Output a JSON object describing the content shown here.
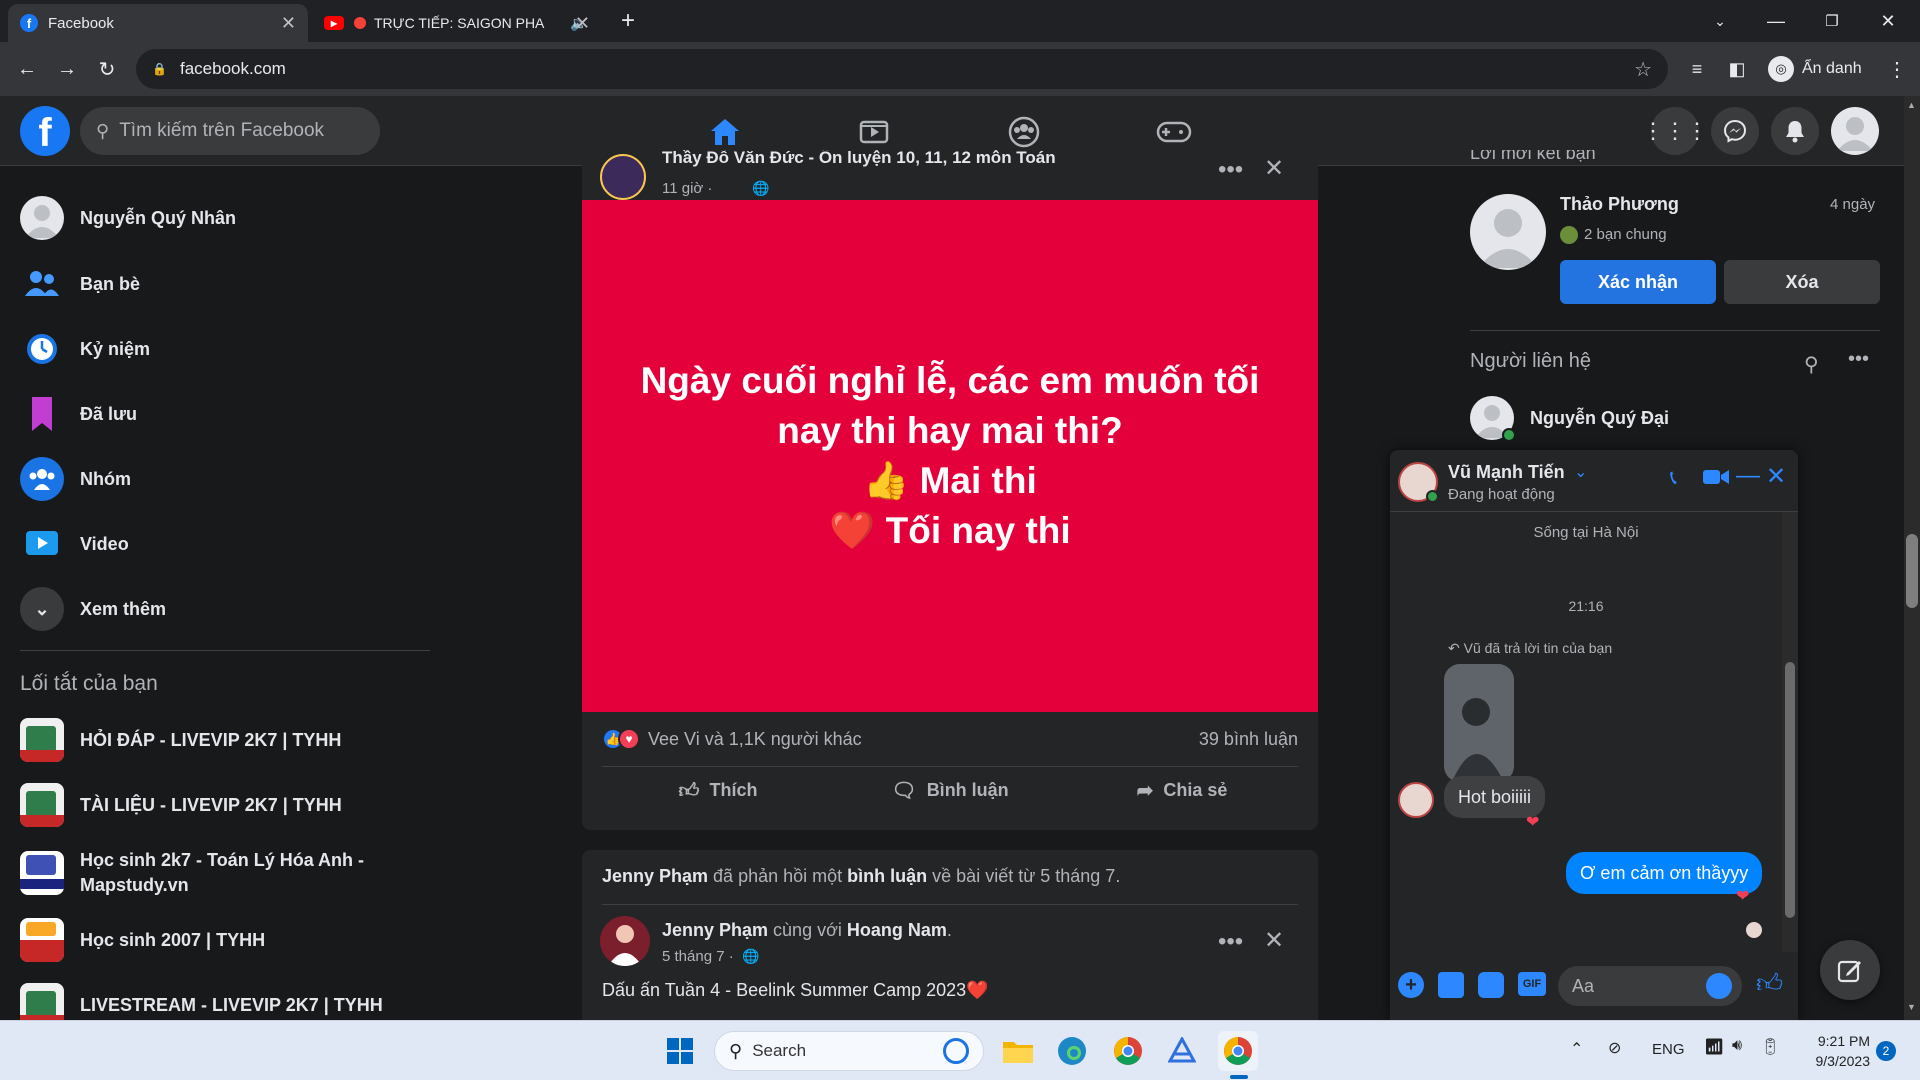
{
  "browser": {
    "tabs": [
      {
        "title": "Facebook",
        "active": true
      },
      {
        "title": "TRỰC TIẾP: SAIGON PHA",
        "active": false
      }
    ],
    "new_tab": "+",
    "url": "facebook.com",
    "profile_label": "Ẩn danh"
  },
  "fb": {
    "search_placeholder": "Tìm kiếm trên Facebook",
    "accent": "#2d88ff"
  },
  "left": {
    "profile_name": "Nguyễn Quý Nhân",
    "items": [
      {
        "label": "Bạn bè",
        "icon": "friends-icon"
      },
      {
        "label": "Kỷ niệm",
        "icon": "memories-icon"
      },
      {
        "label": "Đã lưu",
        "icon": "saved-icon"
      },
      {
        "label": "Nhóm",
        "icon": "groups-icon"
      },
      {
        "label": "Video",
        "icon": "video-icon"
      },
      {
        "label": "Xem thêm",
        "icon": "chevron-down-icon"
      }
    ],
    "shortcuts_title": "Lối tắt của bạn",
    "shortcuts": [
      "HỎI ĐÁP - LIVEVIP 2K7 | TYHH",
      "TÀI LIỆU - LIVEVIP 2K7 | TYHH",
      "Học sinh 2k7 - Toán Lý Hóa Anh - Mapstudy.vn",
      "Học sinh 2007 | TYHH",
      "LIVESTREAM - LIVEVIP 2K7 | TYHH"
    ]
  },
  "post1": {
    "author": "Thầy Đỗ Văn Đức - Ôn luyện 10, 11, 12 môn Toán",
    "time": "11 giờ ·",
    "image_lines": [
      "Ngày cuối nghỉ lễ, các em muốn tối",
      "nay thi hay mai thi?",
      "👍 Mai thi",
      "❤️ Tối nay thi"
    ],
    "reactions_text": "Vee Vi và 1,1K người khác",
    "comments_count": "39 bình luận",
    "actions": [
      "Thích",
      "Bình luận",
      "Chia sẻ"
    ]
  },
  "post2": {
    "activity_user": "Jenny Phạm",
    "activity_mid": " đã phản hồi một ",
    "activity_link": "bình luận",
    "activity_end": " về bài viết từ 5 tháng 7.",
    "author": "Jenny Phạm",
    "with_text": " cùng với ",
    "with_name": "Hoang Nam",
    "with_end": ".",
    "time": "5 tháng 7 ·",
    "body": "Dấu ấn Tuần 4 - Beelink Summer Camp 2023❤️"
  },
  "right": {
    "section_title": "Lời mời kết bạn",
    "request_name": "Thảo Phương",
    "request_time": "4 ngày",
    "mutual": "2 bạn chung",
    "confirm": "Xác nhận",
    "delete": "Xóa",
    "contacts_title": "Người liên hệ",
    "contact_name": "Nguyễn Quý Đại"
  },
  "chat": {
    "name": "Vũ Mạnh Tiến",
    "status": "Đang hoạt động",
    "location": "Sống tại Hà Nội",
    "time_divider": "21:16",
    "reply_note": "Vũ đã trả lời tin của bạn",
    "incoming": "Hot boiiiii",
    "outgoing": "Ơ em cảm ơn thầyyy",
    "input_placeholder": "Aa"
  },
  "taskbar": {
    "search": "Search",
    "lang": "ENG",
    "time": "9:21 PM",
    "date": "9/3/2023",
    "notif": "2"
  }
}
